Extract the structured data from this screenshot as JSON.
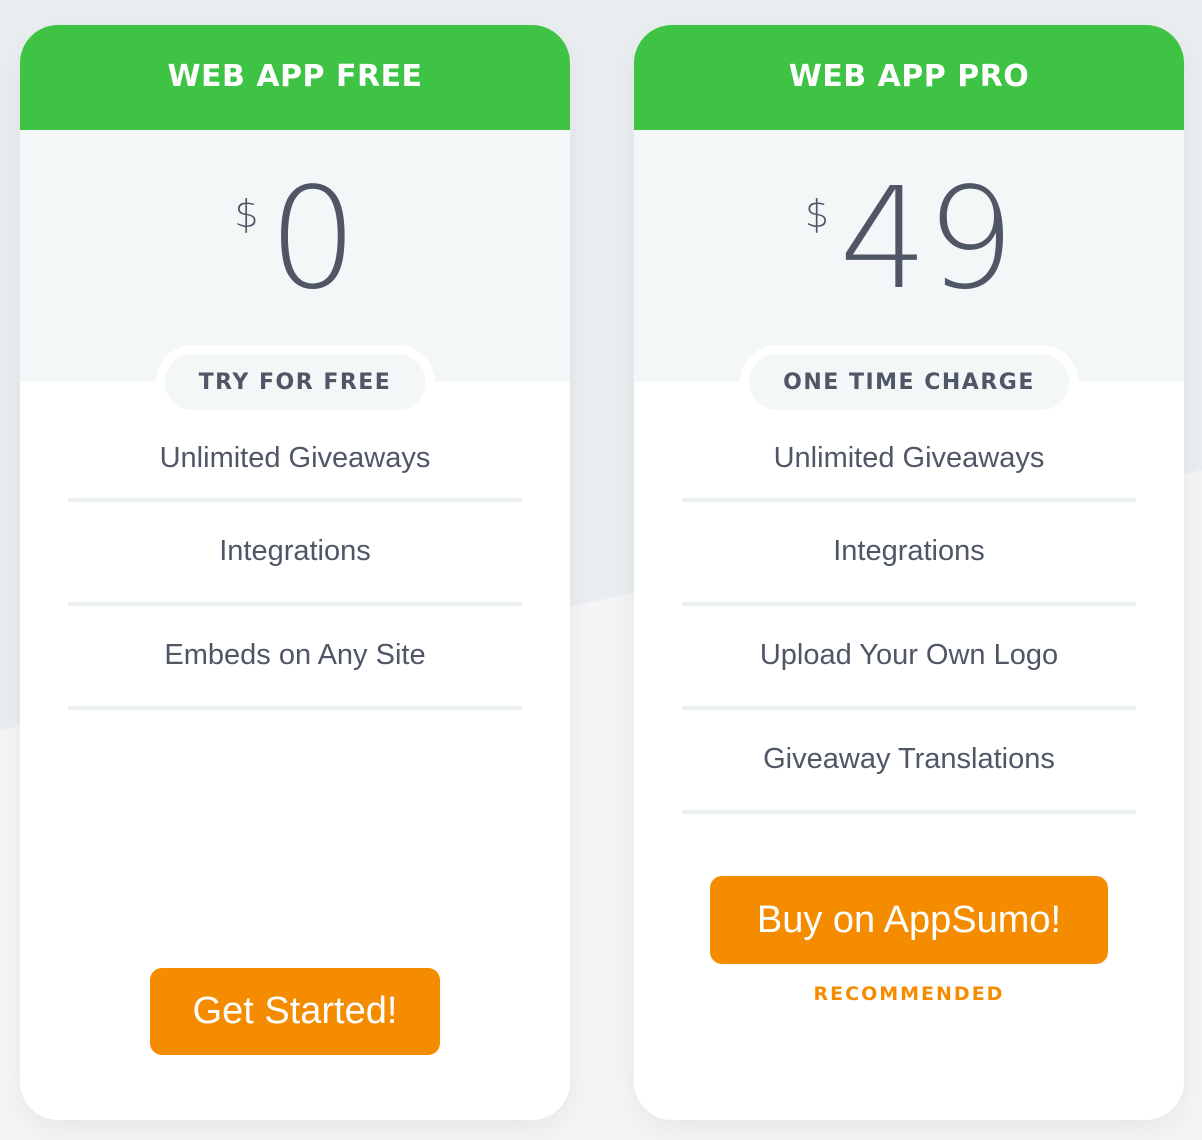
{
  "colors": {
    "header_green": "#3ec345",
    "button_orange": "#f58c00",
    "text_slate": "#4f5666",
    "price_bg": "#f4f7f8",
    "divider": "#ebf0f3"
  },
  "plans": [
    {
      "title": "WEB APP FREE",
      "currency": "$",
      "amount": "0",
      "badge": "TRY FOR FREE",
      "features": [
        "Unlimited Giveaways",
        "Integrations",
        "Embeds on Any Site"
      ],
      "cta": "Get Started!"
    },
    {
      "title": "WEB APP PRO",
      "currency": "$",
      "amount": "49",
      "badge": "ONE TIME CHARGE",
      "features": [
        "Unlimited Giveaways",
        "Integrations",
        "Upload Your Own Logo",
        "Giveaway Translations"
      ],
      "cta": "Buy on AppSumo!",
      "note": "RECOMMENDED"
    }
  ]
}
